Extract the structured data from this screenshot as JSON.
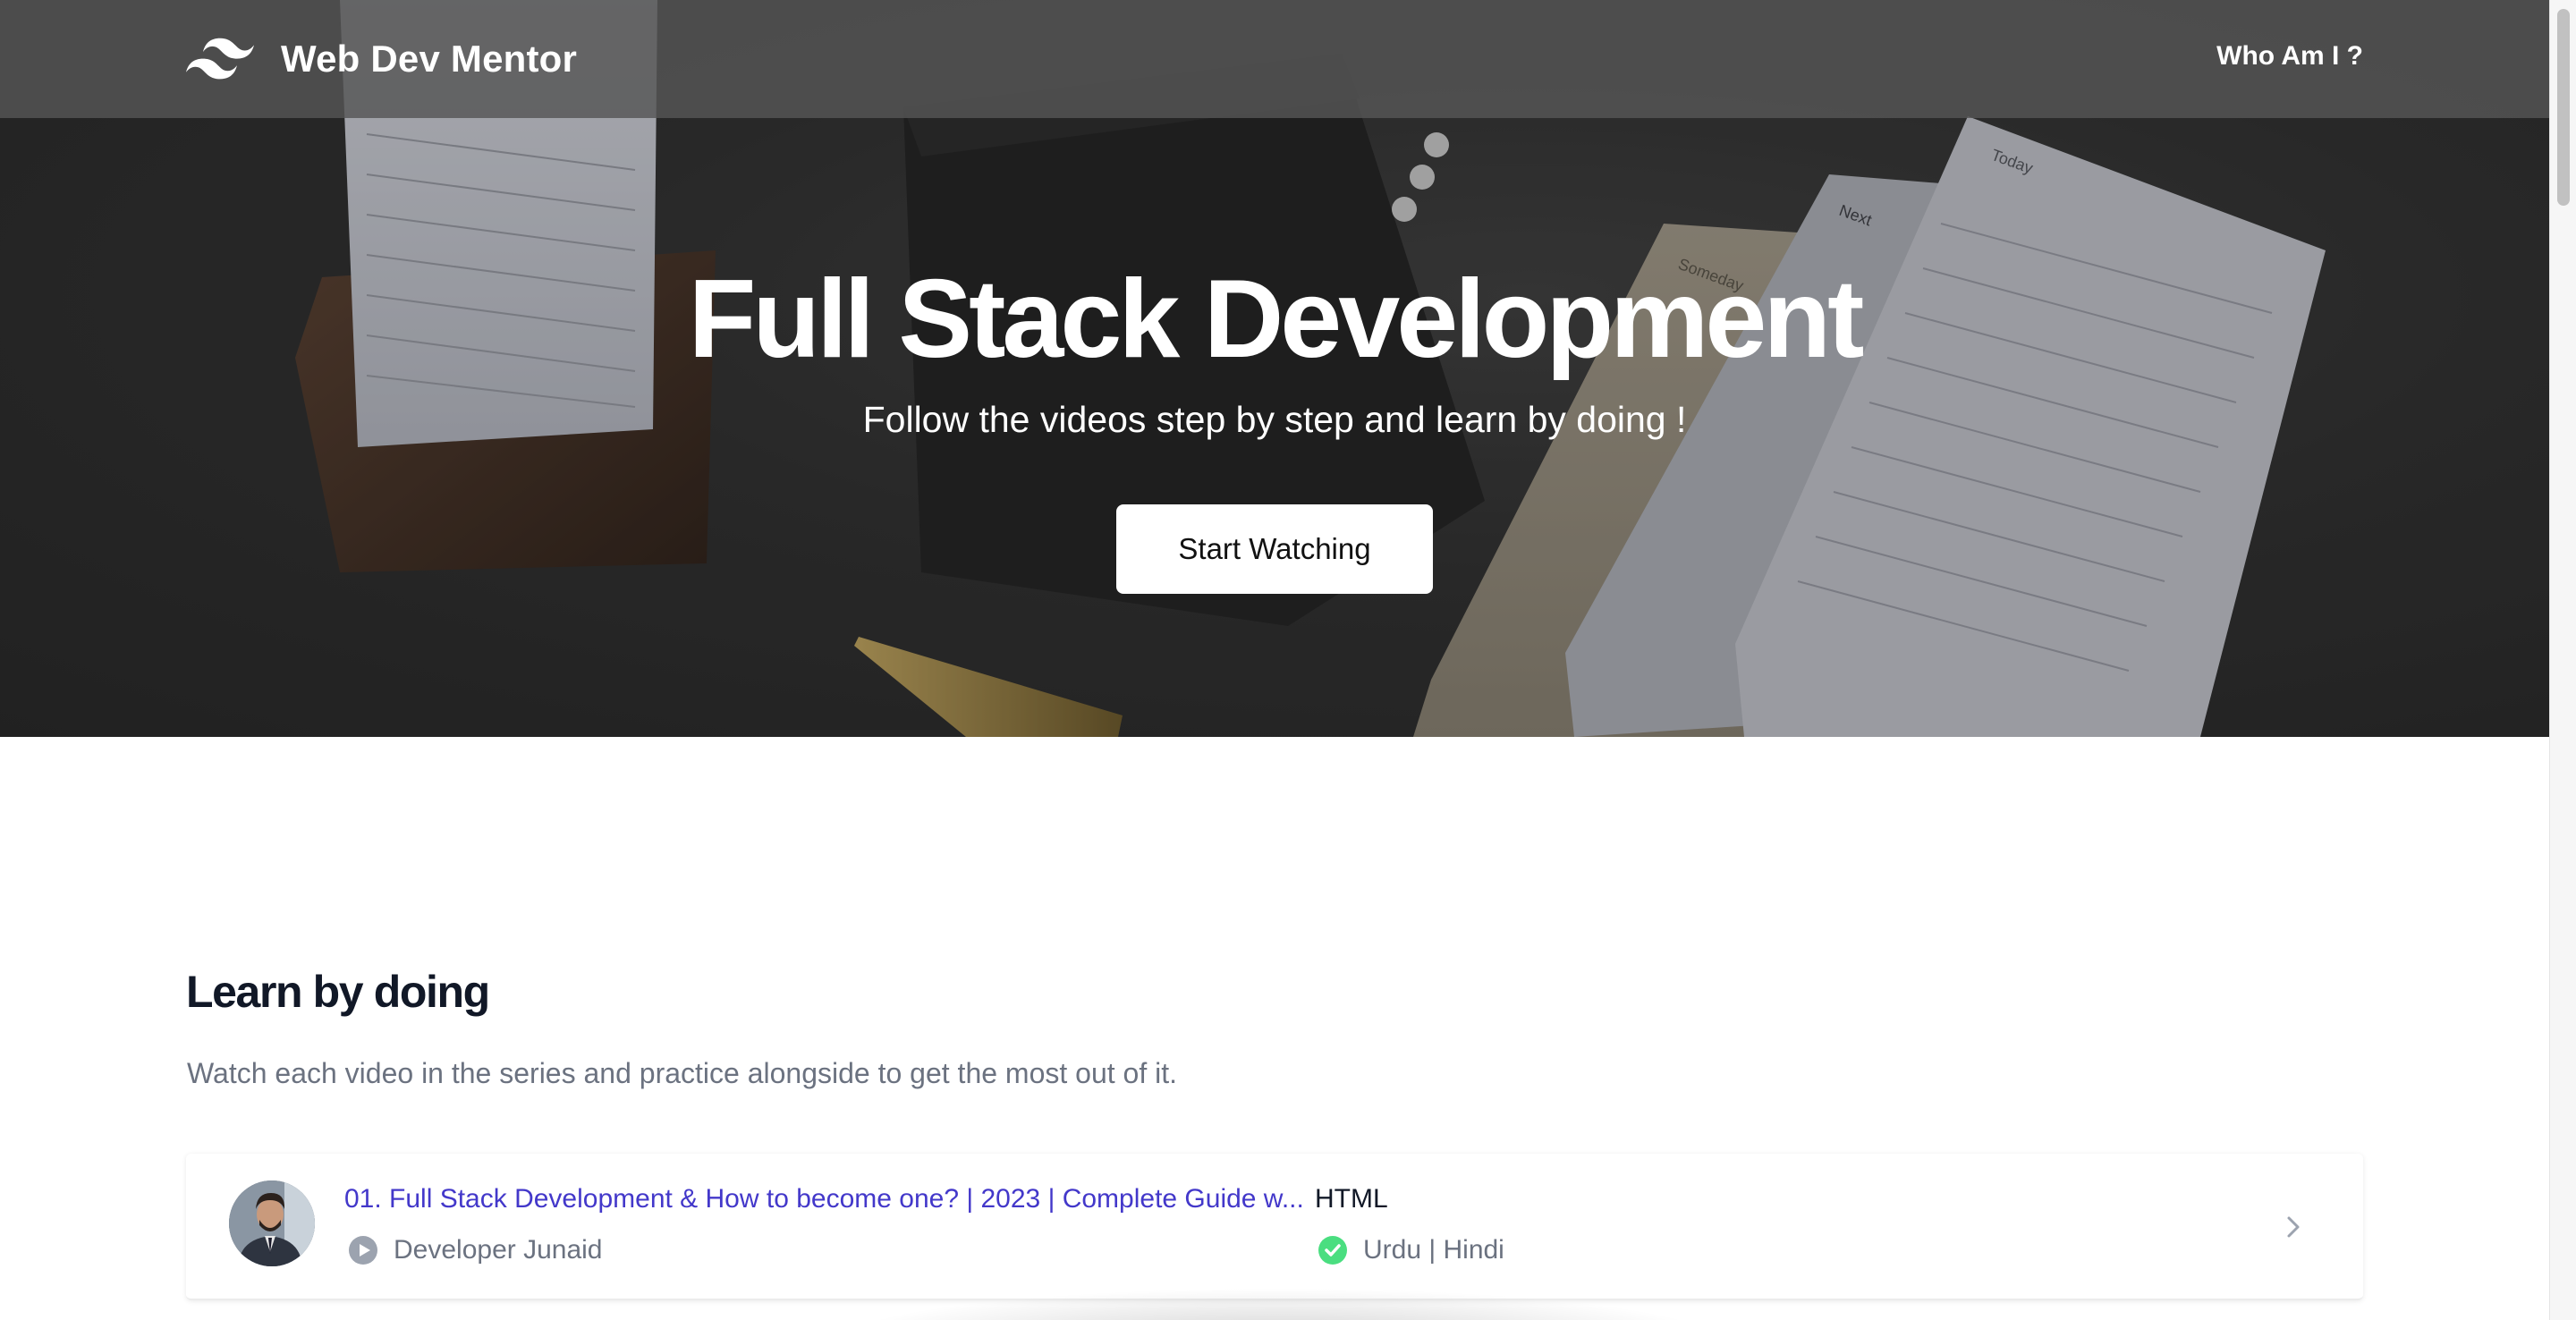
{
  "nav": {
    "brand_name": "Web Dev Mentor",
    "link_label": "Who Am I ?"
  },
  "hero": {
    "title": "Full Stack Development",
    "subtitle": "Follow the videos step by step and learn by doing !",
    "cta_label": "Start Watching",
    "card_labels": {
      "someday": "Someday",
      "next": "Next",
      "today": "Today"
    }
  },
  "section": {
    "title": "Learn by doing",
    "description": "Watch each video in the series and practice alongside to get the most out of it."
  },
  "videos": [
    {
      "title": "01. Full Stack Development & How to become one? | 2023 | Complete Guide w...",
      "author": "Developer Junaid",
      "topic": "HTML",
      "language": "Urdu | Hindi",
      "author_icon": "play-circle-icon",
      "language_icon": "check-circle-icon"
    }
  ],
  "colors": {
    "video_title": "#4338ca",
    "check_green": "#22c55e",
    "heading": "#111827",
    "muted_text": "#6b7280"
  }
}
